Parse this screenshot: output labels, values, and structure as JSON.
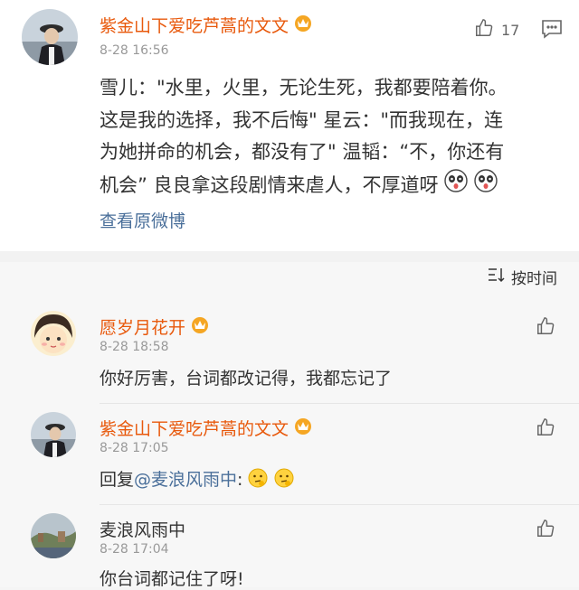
{
  "post": {
    "author": "紫金山下爱吃芦蒿的文文",
    "time": "8-28 16:56",
    "like_count": "17",
    "lines": [
      "雪儿：\"水里，火里，无论生死，我都要陪着你。",
      "这是我的选择，我不后悔\" 星云：\"而我现在，连",
      "为她拼命的机会，都没有了\" 温韬：“不，你还有",
      "机会” 良良拿这段剧情来虐人，不厚道呀"
    ],
    "view_original": "查看原微博"
  },
  "sort": {
    "label": "按时间"
  },
  "comments": [
    {
      "author": "愿岁月花开",
      "time": "8-28 18:58",
      "text": "你好厉害，台词都改记得，我都忘记了"
    },
    {
      "author": "紫金山下爱吃芦蒿的文文",
      "time": "8-28 17:05",
      "reply_prefix": "回复",
      "mention": "@麦浪风雨中",
      "suffix": ":"
    },
    {
      "author": "麦浪风雨中",
      "time": "8-28 17:04",
      "text": "你台词都记住了呀!"
    }
  ],
  "colors": {
    "accent": "#e8590c",
    "link": "#4a6f9a",
    "crown": "#f5a623"
  }
}
